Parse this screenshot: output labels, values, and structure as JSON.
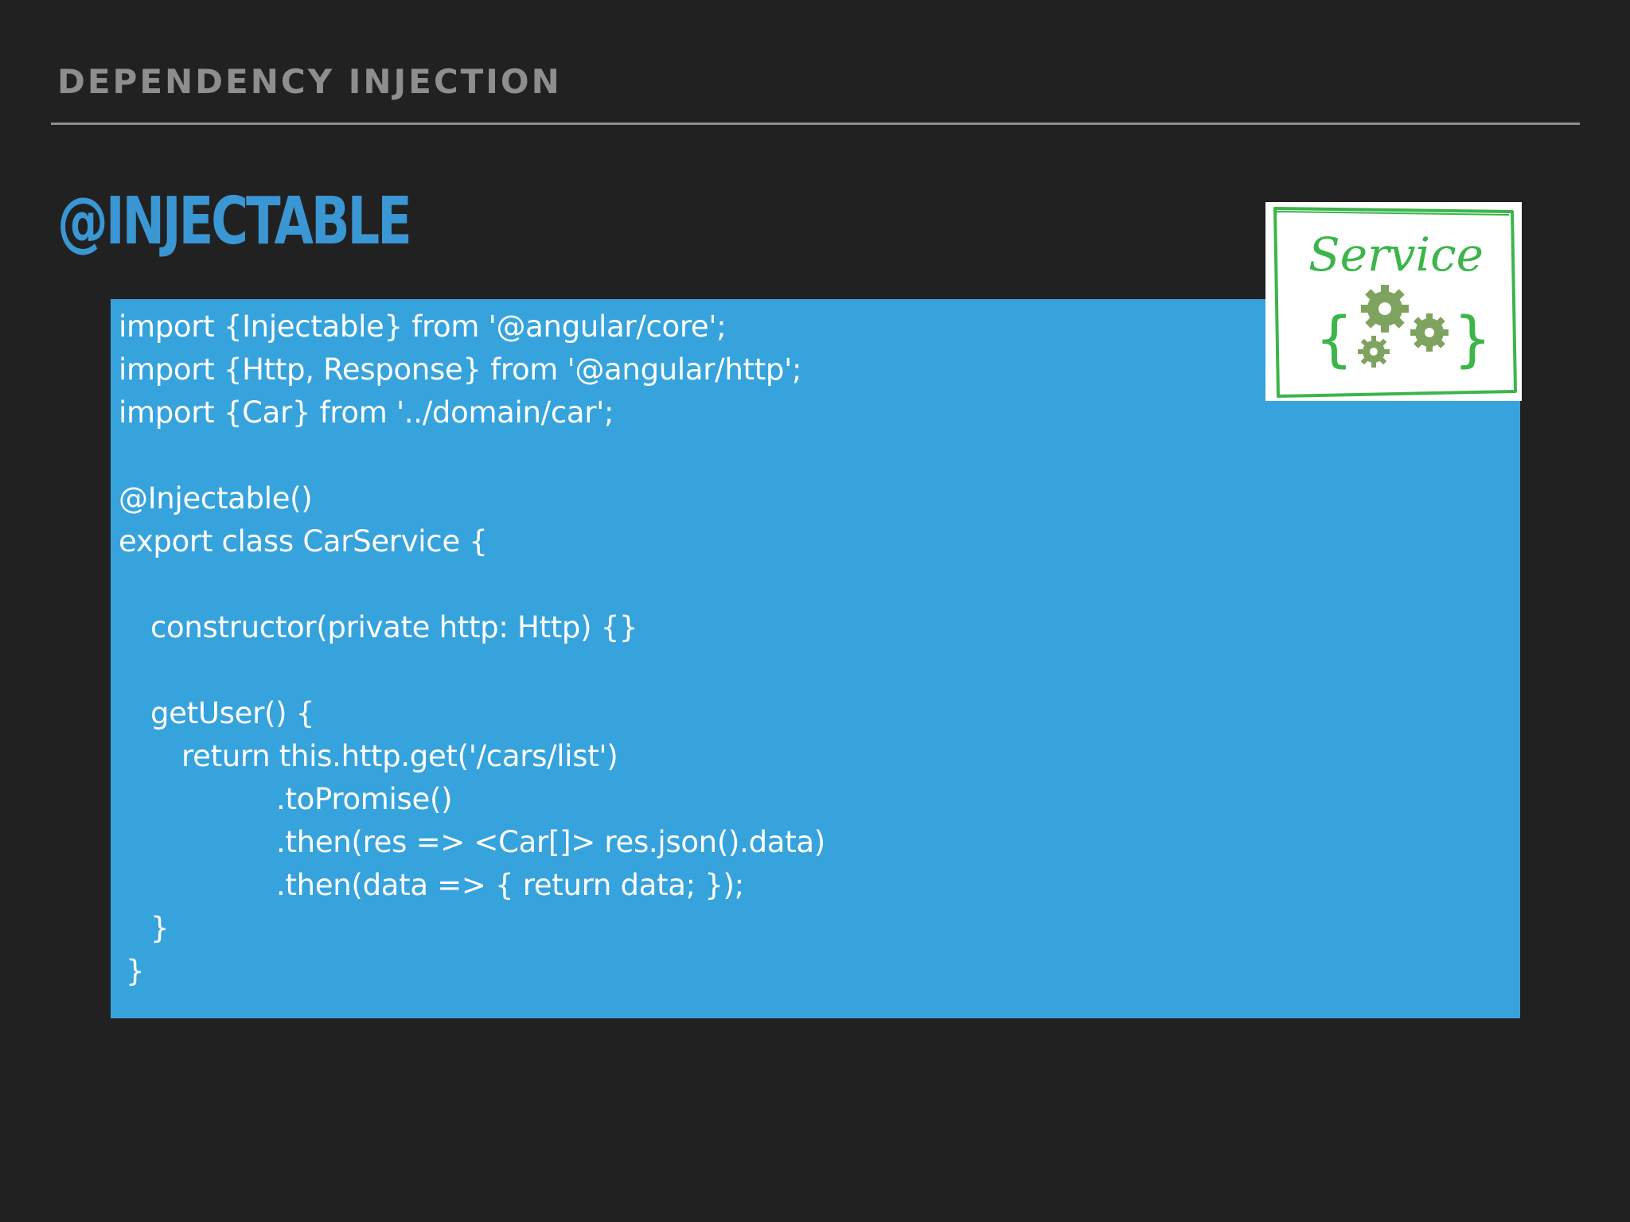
{
  "header": {
    "section_title": "DEPENDENCY INJECTION",
    "slide_title": "@INJECTABLE"
  },
  "code": {
    "lines": [
      "import {Injectable} from '@angular/core';",
      "import {Http, Response} from '@angular/http';",
      "import {Car} from '../domain/car';",
      "",
      "@Injectable()",
      "export class CarService {",
      "",
      "constructor(private http: Http) {}",
      "",
      "getUser() {",
      "return this.http.get('/cars/list')",
      ".toPromise()",
      ".then(res => <Car[]> res.json().data)",
      ".then(data => { return data; });",
      "}",
      "}"
    ]
  },
  "service_card": {
    "label": "Service",
    "icon": "gears-in-braces-icon"
  },
  "colors": {
    "background": "#222122",
    "section_title": "#8e8e8e",
    "slide_title": "#3a97d3",
    "code_background": "#36a3dc",
    "code_text": "#ffffff",
    "service_border": "#3cb54a",
    "gears": "#7ea35f"
  }
}
